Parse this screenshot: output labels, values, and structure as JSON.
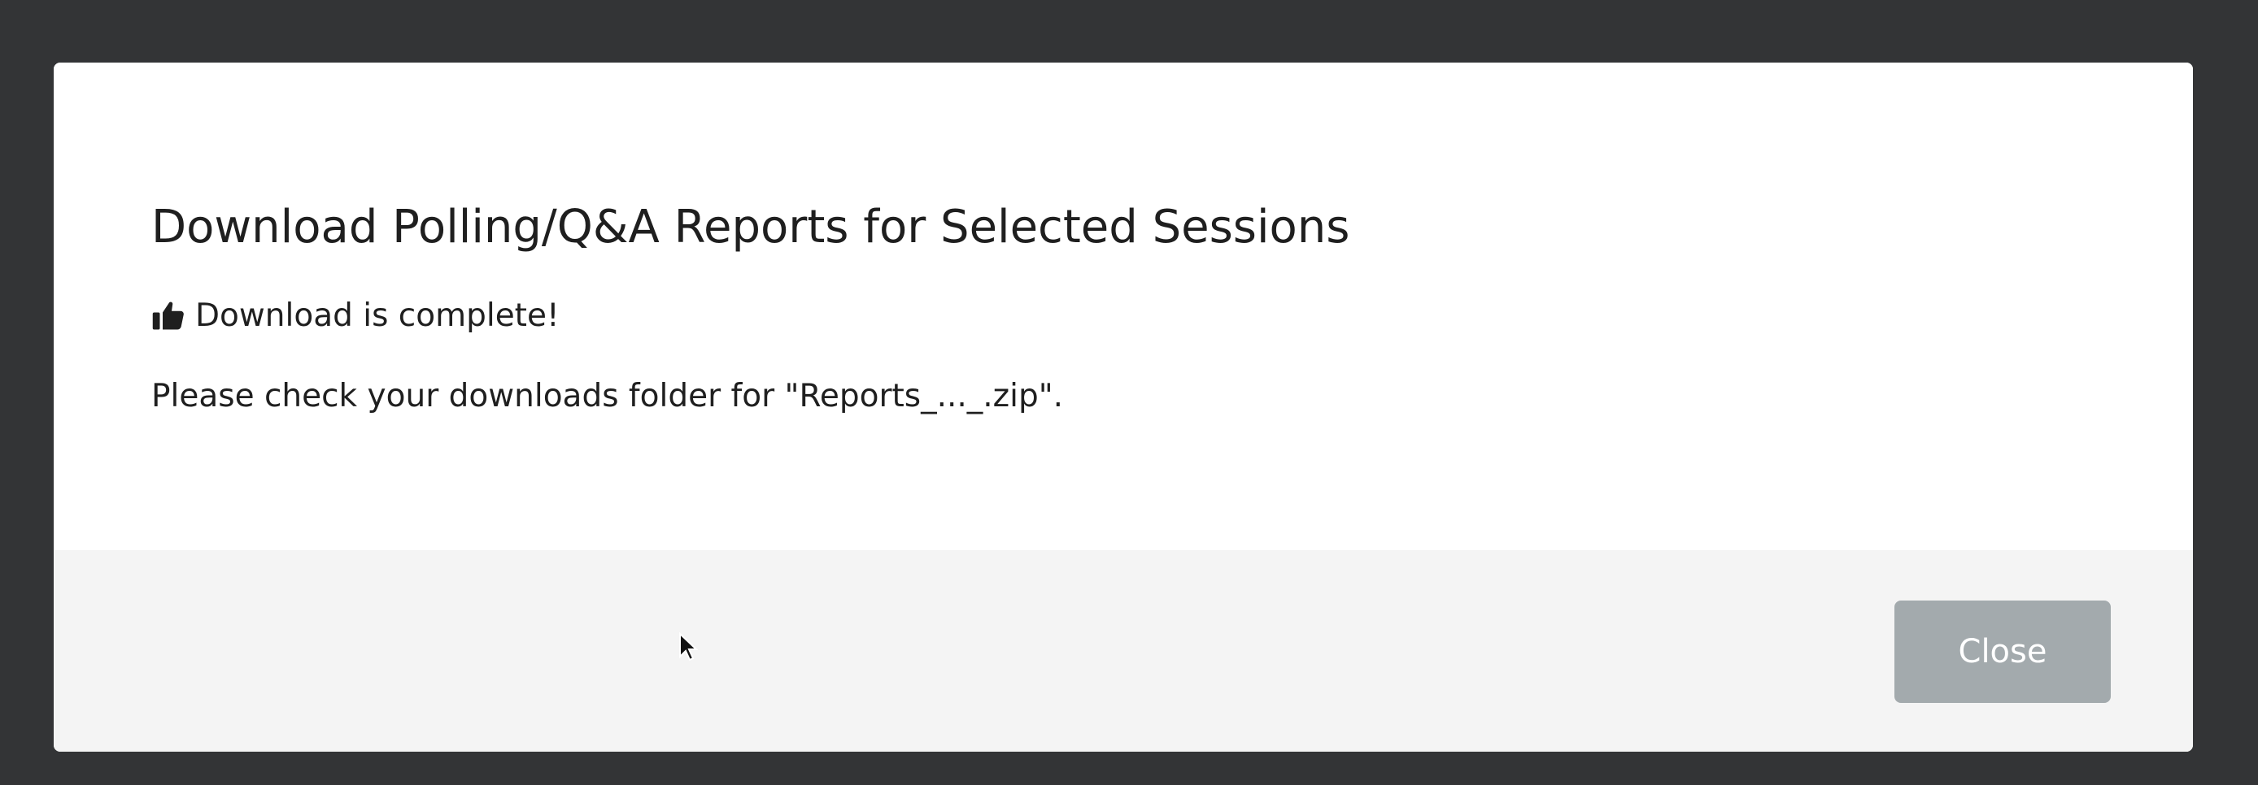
{
  "dialog": {
    "title": "Download Polling/Q&A Reports for Selected Sessions",
    "status": {
      "icon": "thumbs-up-icon",
      "text": "Download is complete!"
    },
    "message": "Please check your downloads folder for \"Reports_..._.zip\".",
    "footer": {
      "close_label": "Close"
    }
  },
  "colors": {
    "backdrop": "#333436",
    "dialog_background": "#ffffff",
    "footer_background": "#f4f4f4",
    "close_button": "#a3aaad",
    "text": "#1f1f1f"
  }
}
